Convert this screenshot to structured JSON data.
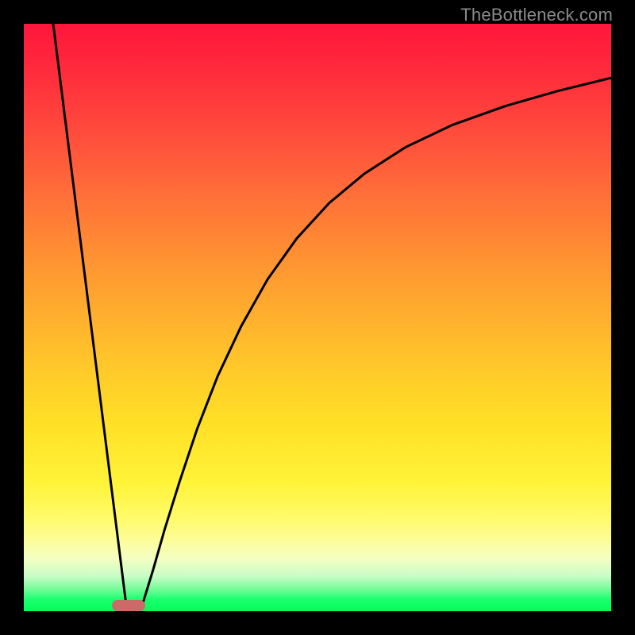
{
  "watermark": {
    "text": "TheBottleneck.com"
  },
  "colors": {
    "page_bg": "#000000",
    "gradient_top": "#ff163b",
    "gradient_bottom": "#00ff5a",
    "curve_stroke": "#000000",
    "marker_fill": "#cc6a68",
    "watermark_color": "#8a8a8a"
  },
  "chart_data": {
    "type": "line",
    "title": "",
    "xlabel": "",
    "ylabel": "",
    "xlim": [
      0,
      100
    ],
    "ylim": [
      0,
      100
    ],
    "grid": false,
    "legend": false,
    "marker": {
      "x_pct": 17.8,
      "width_pct": 5.7
    },
    "series": [
      {
        "name": "left-line",
        "x": [
          5.0,
          17.5
        ],
        "values": [
          100.0,
          0.5
        ]
      },
      {
        "name": "right-curve",
        "x": [
          20.0,
          22.0,
          24.0,
          26.5,
          29.5,
          33.0,
          37.0,
          41.5,
          46.5,
          52.0,
          58.0,
          65.0,
          73.0,
          82.0,
          91.0,
          100.0
        ],
        "values": [
          0.5,
          7.0,
          14.0,
          22.0,
          31.0,
          40.0,
          48.5,
          56.5,
          63.5,
          69.5,
          74.5,
          79.0,
          82.8,
          86.0,
          88.6,
          90.8
        ]
      }
    ]
  }
}
